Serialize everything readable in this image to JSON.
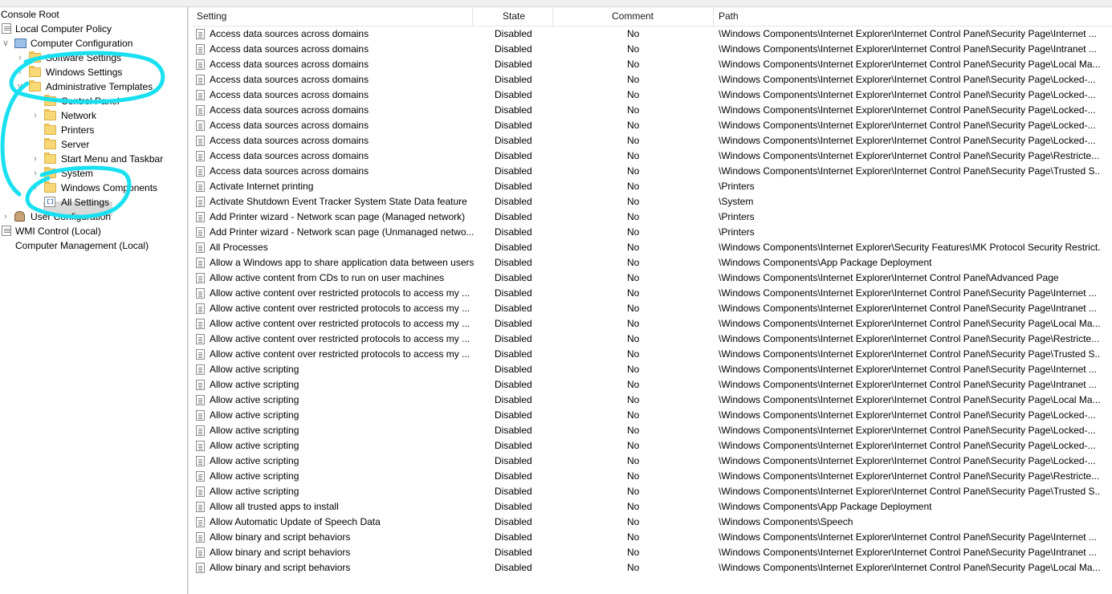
{
  "tree": {
    "items": [
      {
        "label": "Console Root",
        "icon": "none",
        "chevron": ""
      },
      {
        "label": "Local Computer Policy",
        "icon": "policy-icon",
        "chevron": ""
      },
      {
        "label": "Computer Configuration",
        "icon": "computer-icon",
        "chevron": "expanded"
      },
      {
        "label": "Software Settings",
        "icon": "folder-icon",
        "chevron": "collapsed"
      },
      {
        "label": "Windows Settings",
        "icon": "folder-icon",
        "chevron": "collapsed"
      },
      {
        "label": "Administrative Templates",
        "icon": "folder-icon",
        "chevron": "expanded"
      },
      {
        "label": "Control Panel",
        "icon": "folder-icon",
        "chevron": ""
      },
      {
        "label": "Network",
        "icon": "folder-icon",
        "chevron": "collapsed"
      },
      {
        "label": "Printers",
        "icon": "folder-icon",
        "chevron": ""
      },
      {
        "label": "Server",
        "icon": "folder-icon",
        "chevron": ""
      },
      {
        "label": "Start Menu and Taskbar",
        "icon": "folder-icon",
        "chevron": "collapsed"
      },
      {
        "label": "System",
        "icon": "folder-icon",
        "chevron": "collapsed"
      },
      {
        "label": "Windows Components",
        "icon": "folder-icon",
        "chevron": "collapsed"
      },
      {
        "label": "All Settings",
        "icon": "all-settings-icon",
        "chevron": ""
      },
      {
        "label": "User Configuration",
        "icon": "user-icon",
        "chevron": "collapsed"
      },
      {
        "label": "WMI Control (Local)",
        "icon": "doc-icon",
        "chevron": ""
      },
      {
        "label": "Computer Management (Local)",
        "icon": "none",
        "chevron": ""
      }
    ]
  },
  "list": {
    "columns": {
      "setting": "Setting",
      "state": "State",
      "comment": "Comment",
      "path": "Path"
    },
    "rows": [
      {
        "setting": "Access data sources across domains",
        "state": "Disabled",
        "comment": "No",
        "path": "\\Windows Components\\Internet Explorer\\Internet Control Panel\\Security Page\\Internet ..."
      },
      {
        "setting": "Access data sources across domains",
        "state": "Disabled",
        "comment": "No",
        "path": "\\Windows Components\\Internet Explorer\\Internet Control Panel\\Security Page\\Intranet ..."
      },
      {
        "setting": "Access data sources across domains",
        "state": "Disabled",
        "comment": "No",
        "path": "\\Windows Components\\Internet Explorer\\Internet Control Panel\\Security Page\\Local Ma..."
      },
      {
        "setting": "Access data sources across domains",
        "state": "Disabled",
        "comment": "No",
        "path": "\\Windows Components\\Internet Explorer\\Internet Control Panel\\Security Page\\Locked-..."
      },
      {
        "setting": "Access data sources across domains",
        "state": "Disabled",
        "comment": "No",
        "path": "\\Windows Components\\Internet Explorer\\Internet Control Panel\\Security Page\\Locked-..."
      },
      {
        "setting": "Access data sources across domains",
        "state": "Disabled",
        "comment": "No",
        "path": "\\Windows Components\\Internet Explorer\\Internet Control Panel\\Security Page\\Locked-..."
      },
      {
        "setting": "Access data sources across domains",
        "state": "Disabled",
        "comment": "No",
        "path": "\\Windows Components\\Internet Explorer\\Internet Control Panel\\Security Page\\Locked-..."
      },
      {
        "setting": "Access data sources across domains",
        "state": "Disabled",
        "comment": "No",
        "path": "\\Windows Components\\Internet Explorer\\Internet Control Panel\\Security Page\\Locked-..."
      },
      {
        "setting": "Access data sources across domains",
        "state": "Disabled",
        "comment": "No",
        "path": "\\Windows Components\\Internet Explorer\\Internet Control Panel\\Security Page\\Restricte..."
      },
      {
        "setting": "Access data sources across domains",
        "state": "Disabled",
        "comment": "No",
        "path": "\\Windows Components\\Internet Explorer\\Internet Control Panel\\Security Page\\Trusted S..."
      },
      {
        "setting": "Activate Internet printing",
        "state": "Disabled",
        "comment": "No",
        "path": "\\Printers"
      },
      {
        "setting": "Activate Shutdown Event Tracker System State Data feature",
        "state": "Disabled",
        "comment": "No",
        "path": "\\System"
      },
      {
        "setting": "Add Printer wizard - Network scan page (Managed network)",
        "state": "Disabled",
        "comment": "No",
        "path": "\\Printers"
      },
      {
        "setting": "Add Printer wizard - Network scan page (Unmanaged netwo...",
        "state": "Disabled",
        "comment": "No",
        "path": "\\Printers"
      },
      {
        "setting": "All Processes",
        "state": "Disabled",
        "comment": "No",
        "path": "\\Windows Components\\Internet Explorer\\Security Features\\MK Protocol Security Restrict..."
      },
      {
        "setting": "Allow a Windows app to share application data between users",
        "state": "Disabled",
        "comment": "No",
        "path": "\\Windows Components\\App Package Deployment"
      },
      {
        "setting": "Allow active content from CDs to run on user machines",
        "state": "Disabled",
        "comment": "No",
        "path": "\\Windows Components\\Internet Explorer\\Internet Control Panel\\Advanced Page"
      },
      {
        "setting": "Allow active content over restricted protocols to access my ...",
        "state": "Disabled",
        "comment": "No",
        "path": "\\Windows Components\\Internet Explorer\\Internet Control Panel\\Security Page\\Internet ..."
      },
      {
        "setting": "Allow active content over restricted protocols to access my ...",
        "state": "Disabled",
        "comment": "No",
        "path": "\\Windows Components\\Internet Explorer\\Internet Control Panel\\Security Page\\Intranet ..."
      },
      {
        "setting": "Allow active content over restricted protocols to access my ...",
        "state": "Disabled",
        "comment": "No",
        "path": "\\Windows Components\\Internet Explorer\\Internet Control Panel\\Security Page\\Local Ma..."
      },
      {
        "setting": "Allow active content over restricted protocols to access my ...",
        "state": "Disabled",
        "comment": "No",
        "path": "\\Windows Components\\Internet Explorer\\Internet Control Panel\\Security Page\\Restricte..."
      },
      {
        "setting": "Allow active content over restricted protocols to access my ...",
        "state": "Disabled",
        "comment": "No",
        "path": "\\Windows Components\\Internet Explorer\\Internet Control Panel\\Security Page\\Trusted S..."
      },
      {
        "setting": "Allow active scripting",
        "state": "Disabled",
        "comment": "No",
        "path": "\\Windows Components\\Internet Explorer\\Internet Control Panel\\Security Page\\Internet ..."
      },
      {
        "setting": "Allow active scripting",
        "state": "Disabled",
        "comment": "No",
        "path": "\\Windows Components\\Internet Explorer\\Internet Control Panel\\Security Page\\Intranet ..."
      },
      {
        "setting": "Allow active scripting",
        "state": "Disabled",
        "comment": "No",
        "path": "\\Windows Components\\Internet Explorer\\Internet Control Panel\\Security Page\\Local Ma..."
      },
      {
        "setting": "Allow active scripting",
        "state": "Disabled",
        "comment": "No",
        "path": "\\Windows Components\\Internet Explorer\\Internet Control Panel\\Security Page\\Locked-..."
      },
      {
        "setting": "Allow active scripting",
        "state": "Disabled",
        "comment": "No",
        "path": "\\Windows Components\\Internet Explorer\\Internet Control Panel\\Security Page\\Locked-..."
      },
      {
        "setting": "Allow active scripting",
        "state": "Disabled",
        "comment": "No",
        "path": "\\Windows Components\\Internet Explorer\\Internet Control Panel\\Security Page\\Locked-..."
      },
      {
        "setting": "Allow active scripting",
        "state": "Disabled",
        "comment": "No",
        "path": "\\Windows Components\\Internet Explorer\\Internet Control Panel\\Security Page\\Locked-..."
      },
      {
        "setting": "Allow active scripting",
        "state": "Disabled",
        "comment": "No",
        "path": "\\Windows Components\\Internet Explorer\\Internet Control Panel\\Security Page\\Restricte..."
      },
      {
        "setting": "Allow active scripting",
        "state": "Disabled",
        "comment": "No",
        "path": "\\Windows Components\\Internet Explorer\\Internet Control Panel\\Security Page\\Trusted S..."
      },
      {
        "setting": "Allow all trusted apps to install",
        "state": "Disabled",
        "comment": "No",
        "path": "\\Windows Components\\App Package Deployment"
      },
      {
        "setting": "Allow Automatic Update of Speech Data",
        "state": "Disabled",
        "comment": "No",
        "path": "\\Windows Components\\Speech"
      },
      {
        "setting": "Allow binary and script behaviors",
        "state": "Disabled",
        "comment": "No",
        "path": "\\Windows Components\\Internet Explorer\\Internet Control Panel\\Security Page\\Internet ..."
      },
      {
        "setting": "Allow binary and script behaviors",
        "state": "Disabled",
        "comment": "No",
        "path": "\\Windows Components\\Internet Explorer\\Internet Control Panel\\Security Page\\Intranet ..."
      },
      {
        "setting": "Allow binary and script behaviors",
        "state": "Disabled",
        "comment": "No",
        "path": "\\Windows Components\\Internet Explorer\\Internet Control Panel\\Security Page\\Local Ma..."
      }
    ]
  },
  "colors": {
    "annotation": "#19e0f0",
    "selection": "#d9d9d9",
    "folder": "#f8d775"
  }
}
